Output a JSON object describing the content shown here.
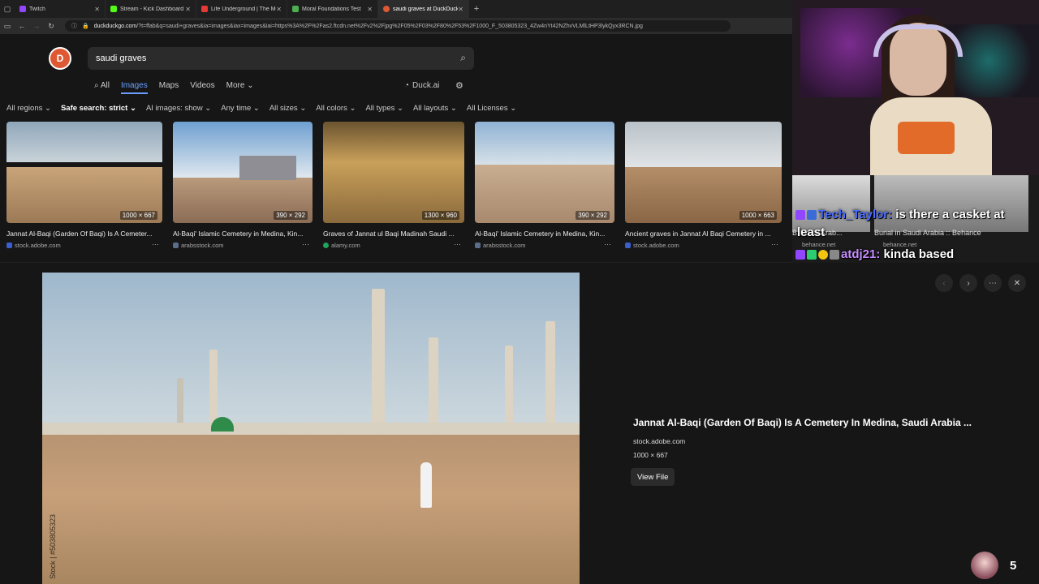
{
  "tabs": [
    {
      "label": "Twitch",
      "color": "#9146ff"
    },
    {
      "label": "Stream - Kick Dashboard",
      "color": "#53fc18"
    },
    {
      "label": "Life Underground | The Mole F",
      "color": "#e53935"
    },
    {
      "label": "Moral Foundations Test",
      "color": "#4caf50"
    },
    {
      "label": "saudi graves at DuckDuckGo",
      "color": "#de5833"
    }
  ],
  "address": {
    "host": "duckduckgo.com",
    "path": "/?t=ffab&q=saudi+graves&ia=images&iax=images&iai=https%3A%2F%2Fas2.ftcdn.net%2Fv2%2Fjpg%2F05%2F03%2F80%2F53%2F1000_F_503805323_4Zw4nYt42NZhvVLMlLtHP3lykQyx3RCN.jpg"
  },
  "search": {
    "query": "saudi graves"
  },
  "vertical_tabs": [
    "All",
    "Images",
    "Maps",
    "Videos",
    "More"
  ],
  "duckai_label": "Duck.ai",
  "filters": [
    "All regions",
    "Safe search: strict",
    "AI images: show",
    "Any time",
    "All sizes",
    "All colors",
    "All types",
    "All layouts",
    "All Licenses"
  ],
  "results": [
    {
      "title": "Jannat Al-Baqi (Garden Of Baqi) Is A Cemeter...",
      "source": "stock.adobe.com",
      "dims": "1000 × 667"
    },
    {
      "title": "Al-Baqi' Islamic Cemetery in Medina, Kin...",
      "source": "arabsstock.com",
      "dims": "390 × 292"
    },
    {
      "title": "Graves of Jannat ul Baqi Madinah Saudi ...",
      "source": "alamy.com",
      "dims": "1300 × 960"
    },
    {
      "title": "Al-Baqi' Islamic Cemetery in Medina, Kin...",
      "source": "arabsstock.com",
      "dims": "390 × 292"
    },
    {
      "title": "Ancient graves in Jannat Al Baqi Cemetery in ...",
      "source": "stock.adobe.com",
      "dims": "1000 × 663"
    }
  ],
  "partial_results": [
    {
      "title": "B... audi Arab...",
      "source": "behance.net"
    },
    {
      "title": "Burial in Saudi Arabia :: Behance",
      "source": "behance.net"
    }
  ],
  "detail": {
    "title": "Jannat Al-Baqi (Garden Of Baqi) Is A Cemetery In Medina, Saudi Arabia ...",
    "source": "stock.adobe.com",
    "dims": "1000 × 667",
    "view_file": "View File",
    "watermark": "Stock | #503805323"
  },
  "chat": [
    {
      "user": "Tech_Taylor:",
      "message": " is there a casket at"
    },
    {
      "user": "",
      "message": "least"
    },
    {
      "user": "atdj21:",
      "message": " kinda based"
    }
  ],
  "viewer_count": "5"
}
